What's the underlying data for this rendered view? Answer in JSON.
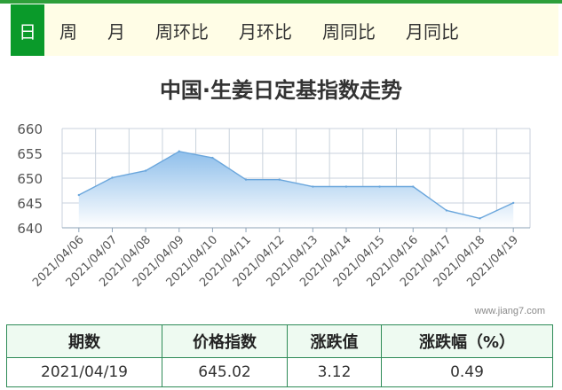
{
  "tabs": [
    {
      "label": "日",
      "active": true
    },
    {
      "label": "周",
      "active": false
    },
    {
      "label": "月",
      "active": false
    },
    {
      "label": "周环比",
      "active": false
    },
    {
      "label": "月环比",
      "active": false
    },
    {
      "label": "周同比",
      "active": false
    },
    {
      "label": "月同比",
      "active": false
    }
  ],
  "watermark": "www.jiang7.com",
  "colors": {
    "accent": "#0a9a2a",
    "line": "#6aa6dc",
    "fill_top": "#8fbfeb",
    "fill_bottom": "#ffffff"
  },
  "chart_data": {
    "type": "area",
    "title": "中国·生姜日定基指数走势",
    "xlabel": "",
    "ylabel": "",
    "ylim": [
      640,
      660
    ],
    "yticks": [
      640,
      645,
      650,
      655,
      660
    ],
    "grid": true,
    "categories": [
      "2021/04/06",
      "2021/04/07",
      "2021/04/08",
      "2021/04/09",
      "2021/04/10",
      "2021/04/11",
      "2021/04/12",
      "2021/04/13",
      "2021/04/14",
      "2021/04/15",
      "2021/04/16",
      "2021/04/17",
      "2021/04/18",
      "2021/04/19"
    ],
    "series": [
      {
        "values": [
          646.6,
          650.1,
          651.5,
          655.4,
          654.1,
          649.7,
          649.7,
          648.3,
          648.3,
          648.3,
          648.3,
          643.5,
          641.9,
          645.02
        ]
      }
    ]
  },
  "table": {
    "headers": [
      "期数",
      "价格指数",
      "涨跌值",
      "涨跌幅（%）"
    ],
    "row": [
      "2021/04/19",
      "645.02",
      "3.12",
      "0.49"
    ]
  }
}
